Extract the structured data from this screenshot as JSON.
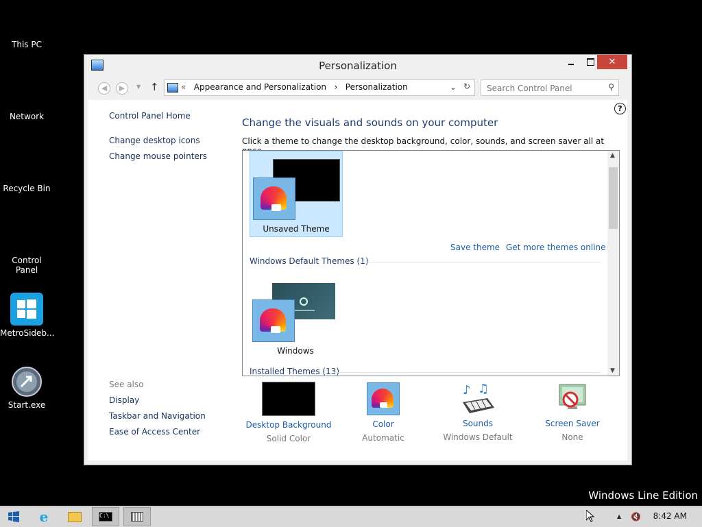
{
  "desktop": {
    "icons": [
      {
        "label": "This PC"
      },
      {
        "label": "Network"
      },
      {
        "label": "Recycle Bin"
      },
      {
        "label": "Control Panel"
      },
      {
        "label": "MetroSideb..."
      },
      {
        "label": "Start.exe"
      }
    ],
    "watermark": "Windows Line Edition"
  },
  "window": {
    "title": "Personalization",
    "close_glyph": "✕",
    "address": {
      "chevrons": "«",
      "crumb1": "Appearance and Personalization",
      "separator": "›",
      "crumb2": "Personalization"
    },
    "search": {
      "placeholder": "Search Control Panel"
    },
    "left_links": {
      "home": "Control Panel Home",
      "desktop_icons": "Change desktop icons",
      "mouse_pointers": "Change mouse pointers"
    },
    "see_also": {
      "header": "See also",
      "items": [
        "Display",
        "Taskbar and Navigation",
        "Ease of Access Center"
      ]
    },
    "heading": "Change the visuals and sounds on your computer",
    "subheading": "Click a theme to change the desktop background, color, sounds, and screen saver all at once.",
    "themes": {
      "selected_theme": "Unsaved Theme",
      "save_theme": "Save theme",
      "get_more": "Get more themes online",
      "group_default": "Windows Default Themes (1)",
      "default_theme": "Windows",
      "group_installed": "Installed Themes (13)"
    },
    "settings": [
      {
        "title": "Desktop Background",
        "value": "Solid Color",
        "icon": "solid-black-swatch"
      },
      {
        "title": "Color",
        "value": "Automatic",
        "icon": "color-fan-icon"
      },
      {
        "title": "Sounds",
        "value": "Windows Default",
        "icon": "music-keyboard-icon"
      },
      {
        "title": "Screen Saver",
        "value": "None",
        "icon": "screensaver-none-icon"
      }
    ]
  },
  "taskbar": {
    "clock": "8:42 AM",
    "tray_arrow": "▲",
    "speaker": "🔇"
  }
}
